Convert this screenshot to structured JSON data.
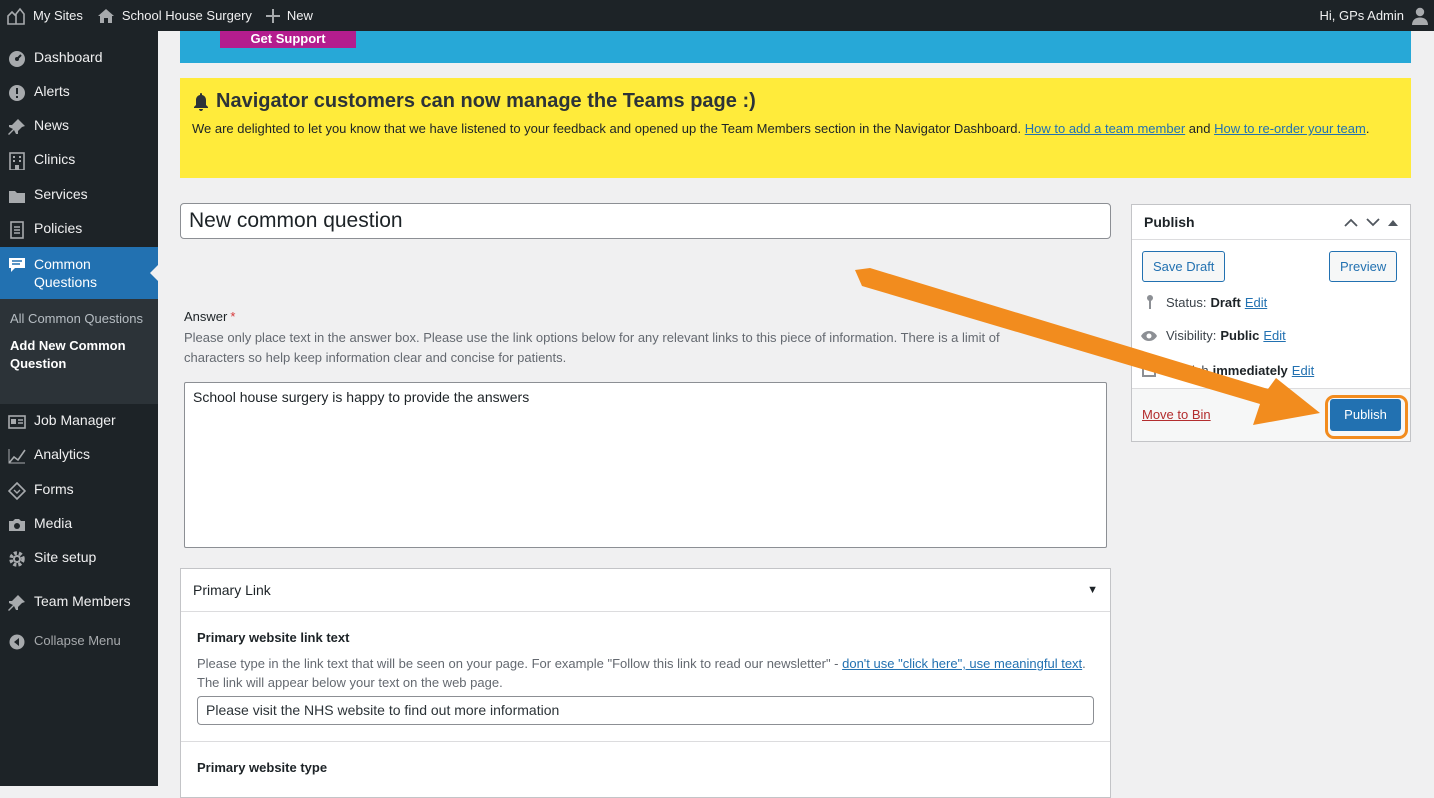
{
  "adminbar": {
    "my_sites": "My Sites",
    "site_name": "School House Surgery",
    "new_label": "New",
    "greeting": "Hi, GPs Admin"
  },
  "sidebar": {
    "items": [
      {
        "label": "Dashboard",
        "icon": "dashboard-icon"
      },
      {
        "label": "Alerts",
        "icon": "alert-icon"
      },
      {
        "label": "News",
        "icon": "pin-icon"
      },
      {
        "label": "Clinics",
        "icon": "building-icon"
      },
      {
        "label": "Services",
        "icon": "folder-icon"
      },
      {
        "label": "Policies",
        "icon": "document-icon"
      },
      {
        "label": "Common Questions",
        "icon": "comment-icon"
      },
      {
        "label": "Job Manager",
        "icon": "id-card-icon"
      },
      {
        "label": "Analytics",
        "icon": "chart-line-icon"
      },
      {
        "label": "Forms",
        "icon": "forms-icon"
      },
      {
        "label": "Media",
        "icon": "camera-icon"
      },
      {
        "label": "Site setup",
        "icon": "gear-icon"
      },
      {
        "label": "Team Members",
        "icon": "pin-icon"
      }
    ],
    "submenu": [
      "All Common Questions",
      "Add New Common Question"
    ],
    "collapse": "Collapse Menu"
  },
  "banner": {
    "get_support": "Get Support"
  },
  "notice": {
    "title": "Navigator customers can now manage the Teams page :)",
    "text_before": "We are delighted to let you know that we have listened to your feedback and opened up the Team Members section in the Navigator Dashboard. ",
    "link1": "How to add a team member",
    "text_mid": " and ",
    "link2": "How to re-order your team",
    "text_end": "."
  },
  "post": {
    "title_value": "New common question"
  },
  "answer": {
    "label": "Answer",
    "required": "*",
    "desc_line1": "Please only place text in the answer box. Please use the link options below for any relevant links to this piece of information. There is a limit of",
    "desc_line2": "characters so help keep information clear and concise for patients.",
    "value": "School house surgery is happy to provide the answers"
  },
  "primary_link": {
    "heading": "Primary Link",
    "toggle": "▼",
    "text_label": "Primary website link text",
    "desc_before": "Please type in the link text that will be seen on your page. For example \"Follow this link to read our newsletter\" - ",
    "desc_link": "don't use \"click here\", use meaningful text",
    "desc_after": ". The link will appear below your text on the web page.",
    "text_value": "Please visit the NHS website to find out more information",
    "type_label": "Primary website type"
  },
  "publish": {
    "title": "Publish",
    "save_draft": "Save Draft",
    "preview": "Preview",
    "status_label": "Status:",
    "status_value": "Draft",
    "visibility_label": "Visibility:",
    "visibility_value": "Public",
    "publish_label": "Publish",
    "publish_value": "immediately",
    "edit": "Edit",
    "move_to_bin": "Move to Bin",
    "publish_button": "Publish"
  },
  "colors": {
    "admin_bar": "#1d2327",
    "accent": "#2271b1",
    "notice": "#ffeb3b",
    "banner": "#27a8d7",
    "support": "#b41d8e",
    "arrow": "#f28c1e"
  }
}
